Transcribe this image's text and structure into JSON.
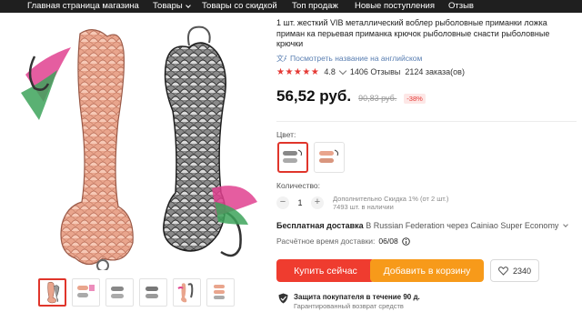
{
  "nav": {
    "items": [
      {
        "label": "Главная страница магазина",
        "dropdown": false
      },
      {
        "label": "Товары",
        "dropdown": true
      },
      {
        "label": "Товары со скидкой",
        "dropdown": false
      },
      {
        "label": "Топ продаж",
        "dropdown": false
      },
      {
        "label": "Новые поступления",
        "dropdown": false
      },
      {
        "label": "Отзыв",
        "dropdown": false
      }
    ]
  },
  "product": {
    "title": "1 шт. жесткий VIB металлический воблер рыболовные приманки ложка приман ка перьевая приманка крючок рыболовные снасти рыболовные крючки",
    "translate_link": "Посмотреть название на английском",
    "rating": "4.8",
    "rating_stars": 4.8,
    "reviews": "1406 Отзывы",
    "orders": "2124 заказа(ов)",
    "price": "56,52 руб.",
    "old_price": "90,83 руб.",
    "discount": "-38%"
  },
  "options": {
    "color_label": "Цвет:",
    "colors": [
      {
        "icon": "silver-lure-icon",
        "selected": true
      },
      {
        "icon": "rose-gold-lure-icon",
        "selected": false
      }
    ],
    "quantity_label": "Количество:",
    "quantity": "1",
    "quantity_note_line1": "Дополнительно Скидка 1% (от 2 шт.)",
    "quantity_note_line2": "7493 шт. в наличии"
  },
  "shipping": {
    "title": "Бесплатная доставка",
    "rest": "В Russian Federation через Cainiao Super Economy",
    "delivery_label": "Расчётное время доставки:",
    "delivery_date": "06/08"
  },
  "actions": {
    "buy_label": "Купить сейчас",
    "cart_label": "Добавить в корзину",
    "wishlist_count": "2340"
  },
  "protection": {
    "title": "Защита покупателя в течение 90 д.",
    "subtitle": "Гарантированный возврат средств"
  },
  "colors": {
    "nav_bg": "#1f1f1f",
    "accent_red": "#ef3c2f",
    "accent_orange": "#f79a1a",
    "link_blue": "#5a7fb2"
  },
  "gallery": {
    "thumbnails": [
      "rose-gold-lure-icon",
      "rose-gold-lure-icon",
      "silver-lure-icon",
      "silver-lure-icon",
      "rose-gold-lure-icon",
      "rose-gold-lure-icon"
    ],
    "active_index": 0
  }
}
